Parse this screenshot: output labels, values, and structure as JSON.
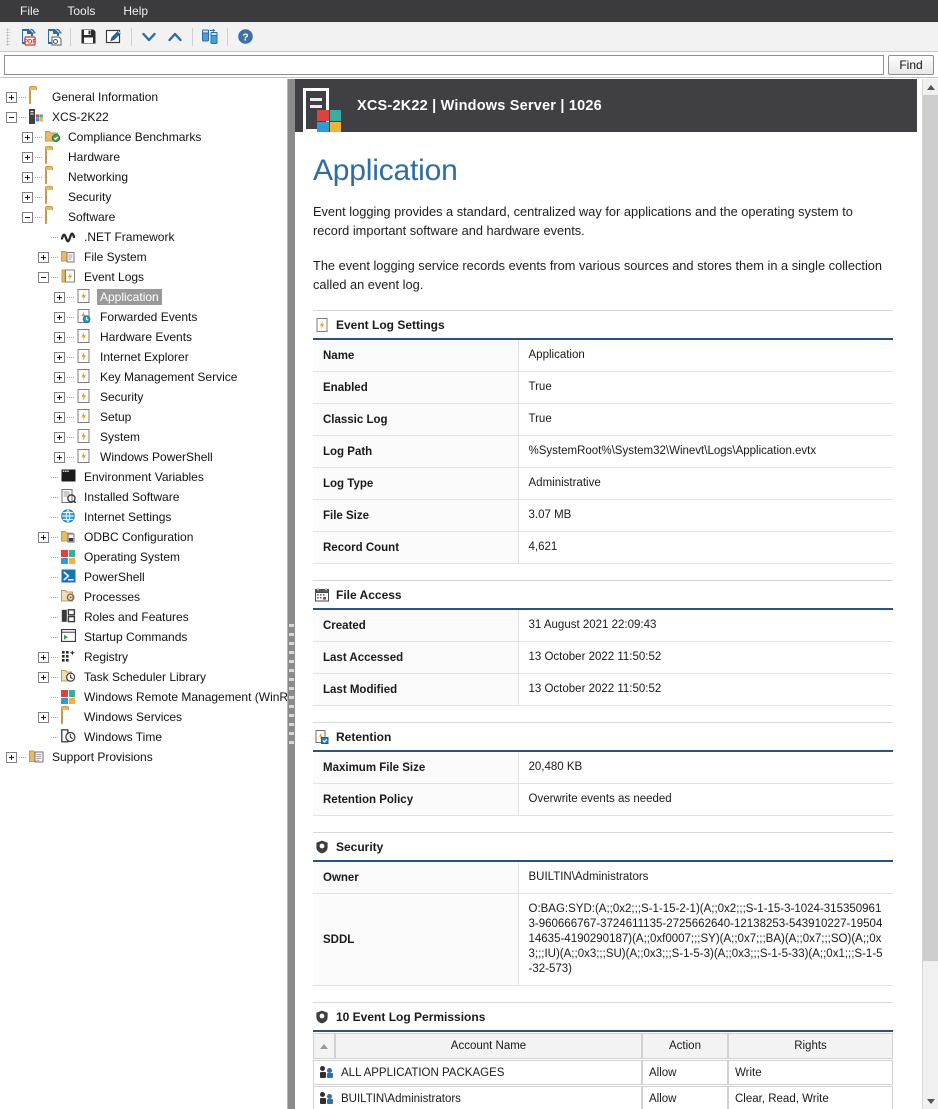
{
  "menubar": {
    "items": [
      {
        "label": "File",
        "name": "menu-file"
      },
      {
        "label": "Tools",
        "name": "menu-tools"
      },
      {
        "label": "Help",
        "name": "menu-help"
      }
    ]
  },
  "toolbar": {
    "buttons": [
      {
        "icon": "export-pdf-icon",
        "title": "Export to PDF"
      },
      {
        "icon": "export-report-icon",
        "title": "Export Report"
      },
      {
        "icon": "save-icon",
        "title": "Save"
      },
      {
        "icon": "edit-icon",
        "title": "Edit"
      },
      {
        "icon": "chevron-down-icon",
        "title": "Next"
      },
      {
        "icon": "chevron-up-icon",
        "title": "Previous"
      },
      {
        "icon": "database-transfer-icon",
        "title": "Transfer"
      },
      {
        "icon": "help-icon",
        "title": "Help"
      }
    ]
  },
  "find": {
    "value": "",
    "placeholder": "",
    "button_label": "Find"
  },
  "tree": {
    "items": [
      {
        "label": "General Information",
        "depth": 0,
        "twisty": "plus",
        "icon": "folder"
      },
      {
        "label": "XCS-2K22",
        "depth": 0,
        "twisty": "minus",
        "icon": "server"
      },
      {
        "label": "Compliance Benchmarks",
        "depth": 1,
        "twisty": "plus",
        "icon": "folder-check"
      },
      {
        "label": "Hardware",
        "depth": 1,
        "twisty": "plus",
        "icon": "folder"
      },
      {
        "label": "Networking",
        "depth": 1,
        "twisty": "plus",
        "icon": "folder"
      },
      {
        "label": "Security",
        "depth": 1,
        "twisty": "plus",
        "icon": "folder"
      },
      {
        "label": "Software",
        "depth": 1,
        "twisty": "minus",
        "icon": "folder-open"
      },
      {
        "label": ".NET Framework",
        "depth": 2,
        "twisty": "none",
        "icon": "dotnet"
      },
      {
        "label": "File System",
        "depth": 2,
        "twisty": "plus",
        "icon": "filesystem"
      },
      {
        "label": "Event Logs",
        "depth": 2,
        "twisty": "minus",
        "icon": "eventlogs"
      },
      {
        "label": "Application",
        "depth": 3,
        "twisty": "plus",
        "icon": "event",
        "selected": true
      },
      {
        "label": "Forwarded Events",
        "depth": 3,
        "twisty": "plus",
        "icon": "event-fwd"
      },
      {
        "label": "Hardware Events",
        "depth": 3,
        "twisty": "plus",
        "icon": "event"
      },
      {
        "label": "Internet Explorer",
        "depth": 3,
        "twisty": "plus",
        "icon": "event"
      },
      {
        "label": "Key Management Service",
        "depth": 3,
        "twisty": "plus",
        "icon": "event"
      },
      {
        "label": "Security",
        "depth": 3,
        "twisty": "plus",
        "icon": "event"
      },
      {
        "label": "Setup",
        "depth": 3,
        "twisty": "plus",
        "icon": "event"
      },
      {
        "label": "System",
        "depth": 3,
        "twisty": "plus",
        "icon": "event"
      },
      {
        "label": "Windows PowerShell",
        "depth": 3,
        "twisty": "plus",
        "icon": "event"
      },
      {
        "label": "Environment Variables",
        "depth": 2,
        "twisty": "none",
        "icon": "envvar"
      },
      {
        "label": "Installed Software",
        "depth": 2,
        "twisty": "none",
        "icon": "installed"
      },
      {
        "label": "Internet Settings",
        "depth": 2,
        "twisty": "none",
        "icon": "globe"
      },
      {
        "label": "ODBC Configuration",
        "depth": 2,
        "twisty": "plus",
        "icon": "odbc"
      },
      {
        "label": "Operating System",
        "depth": 2,
        "twisty": "none",
        "icon": "windows"
      },
      {
        "label": "PowerShell",
        "depth": 2,
        "twisty": "none",
        "icon": "powershell"
      },
      {
        "label": "Processes",
        "depth": 2,
        "twisty": "none",
        "icon": "processes"
      },
      {
        "label": "Roles and Features",
        "depth": 2,
        "twisty": "none",
        "icon": "roles"
      },
      {
        "label": "Startup Commands",
        "depth": 2,
        "twisty": "none",
        "icon": "startup"
      },
      {
        "label": "Registry",
        "depth": 2,
        "twisty": "plus",
        "icon": "registry"
      },
      {
        "label": "Task Scheduler Library",
        "depth": 2,
        "twisty": "plus",
        "icon": "task"
      },
      {
        "label": "Windows Remote Management (WinRM)",
        "depth": 2,
        "twisty": "none",
        "icon": "winrm"
      },
      {
        "label": "Windows Services",
        "depth": 2,
        "twisty": "plus",
        "icon": "folder"
      },
      {
        "label": "Windows Time",
        "depth": 2,
        "twisty": "none",
        "icon": "wintime"
      },
      {
        "label": "Support Provisions",
        "depth": 0,
        "twisty": "plus",
        "icon": "support"
      }
    ]
  },
  "page": {
    "header_title": "XCS-2K22 | Windows Server | 1026",
    "title": "Application",
    "paragraph1": "Event logging provides a standard, centralized way for applications and the operating system to record important software and hardware events.",
    "paragraph2": "The event logging service records events from various sources and stores them in a single collection called an event log."
  },
  "sections": {
    "event_log_settings": {
      "title": "Event Log Settings",
      "icon": "event-log-icon",
      "rows": [
        {
          "key": "Name",
          "value": "Application"
        },
        {
          "key": "Enabled",
          "value": "True"
        },
        {
          "key": "Classic Log",
          "value": "True"
        },
        {
          "key": "Log Path",
          "value": "%SystemRoot%\\System32\\Winevt\\Logs\\Application.evtx"
        },
        {
          "key": "Log Type",
          "value": "Administrative"
        },
        {
          "key": "File Size",
          "value": "3.07 MB"
        },
        {
          "key": "Record Count",
          "value": "4,621"
        }
      ]
    },
    "file_access": {
      "title": "File Access",
      "icon": "calendar-icon",
      "rows": [
        {
          "key": "Created",
          "value": "31 August 2021 22:09:43"
        },
        {
          "key": "Last Accessed",
          "value": "13 October 2022 11:50:52"
        },
        {
          "key": "Last Modified",
          "value": "13 October 2022 11:50:52"
        }
      ]
    },
    "retention": {
      "title": "Retention",
      "icon": "retention-icon",
      "rows": [
        {
          "key": "Maximum File Size",
          "value": "20,480 KB"
        },
        {
          "key": "Retention Policy",
          "value": "Overwrite events as needed"
        }
      ]
    },
    "security": {
      "title": "Security",
      "icon": "shield-icon",
      "rows": [
        {
          "key": "Owner",
          "value": "BUILTIN\\Administrators"
        },
        {
          "key": "SDDL",
          "value": "O:BAG:SYD:(A;;0x2;;;S-1-15-2-1)(A;;0x2;;;S-1-15-3-1024-3153509613-960666767-3724611135-2725662640-12138253-543910227-1950414635-4190290187)(A;;0xf0007;;;SY)(A;;0x7;;;BA)(A;;0x7;;;SO)(A;;0x3;;;IU)(A;;0x3;;;SU)(A;;0x3;;;S-1-5-3)(A;;0x3;;;S-1-5-33)(A;;0x1;;;S-1-5-32-573)"
        }
      ]
    },
    "permissions": {
      "title": "10 Event Log Permissions",
      "icon": "shield-icon",
      "columns": [
        "",
        "Account Name",
        "Action",
        "Rights"
      ],
      "rows": [
        {
          "account": "ALL APPLICATION PACKAGES",
          "action": "Allow",
          "rights": "Write"
        },
        {
          "account": "BUILTIN\\Administrators",
          "action": "Allow",
          "rights": "Clear, Read, Write"
        }
      ]
    }
  },
  "colors": {
    "accent_blue": "#2e6da4",
    "section_rule": "#27557e",
    "header_bar": "#3f3f44",
    "menubar": "#3b3b3e",
    "selection": "#9a9a9a"
  }
}
